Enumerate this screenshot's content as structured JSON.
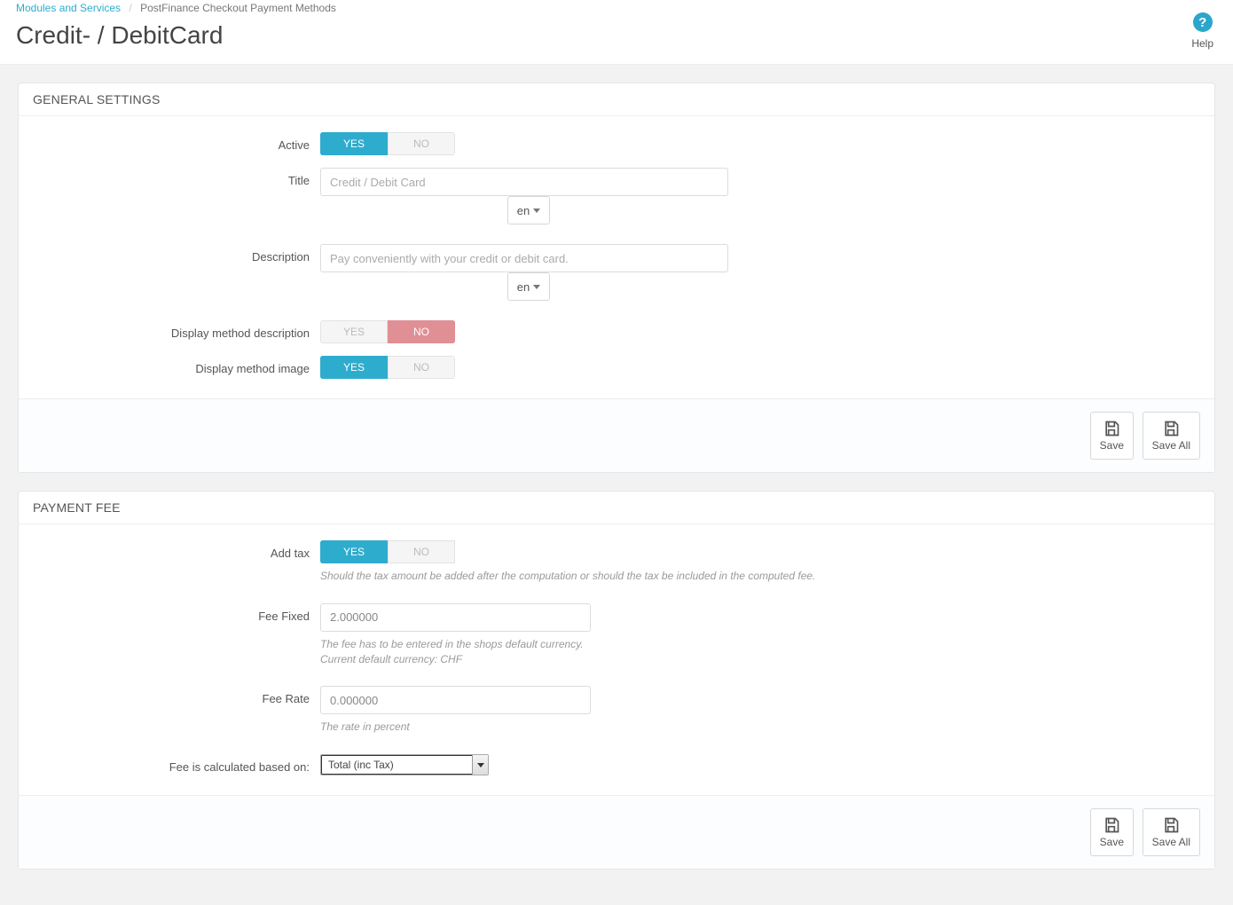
{
  "breadcrumb": {
    "root": "Modules and Services",
    "current": "PostFinance Checkout Payment Methods"
  },
  "page_title": "Credit- / DebitCard",
  "help": {
    "label": "Help",
    "glyph": "?"
  },
  "panels": {
    "general": {
      "title": "GENERAL SETTINGS",
      "active": {
        "label": "Active",
        "value": "YES",
        "yes": "YES",
        "no": "NO"
      },
      "title_field": {
        "label": "Title",
        "placeholder": "Credit / Debit Card",
        "lang": "en"
      },
      "description_field": {
        "label": "Description",
        "placeholder": "Pay conveniently with your credit or debit card.",
        "lang": "en"
      },
      "display_desc": {
        "label": "Display method description",
        "value": "NO",
        "yes": "YES",
        "no": "NO"
      },
      "display_image": {
        "label": "Display method image",
        "value": "YES",
        "yes": "YES",
        "no": "NO"
      }
    },
    "fee": {
      "title": "PAYMENT FEE",
      "add_tax": {
        "label": "Add tax",
        "value": "YES",
        "yes": "YES",
        "no": "NO",
        "help": "Should the tax amount be added after the computation or should the tax be included in the computed fee."
      },
      "fee_fixed": {
        "label": "Fee Fixed",
        "value": "2.000000",
        "help1": "The fee has to be entered in the shops default currency.",
        "help2": "Current default currency: CHF"
      },
      "fee_rate": {
        "label": "Fee Rate",
        "value": "0.000000",
        "help": "The rate in percent"
      },
      "fee_base": {
        "label": "Fee is calculated based on:",
        "value": "Total (inc Tax)"
      }
    }
  },
  "buttons": {
    "save": "Save",
    "save_all": "Save All"
  }
}
